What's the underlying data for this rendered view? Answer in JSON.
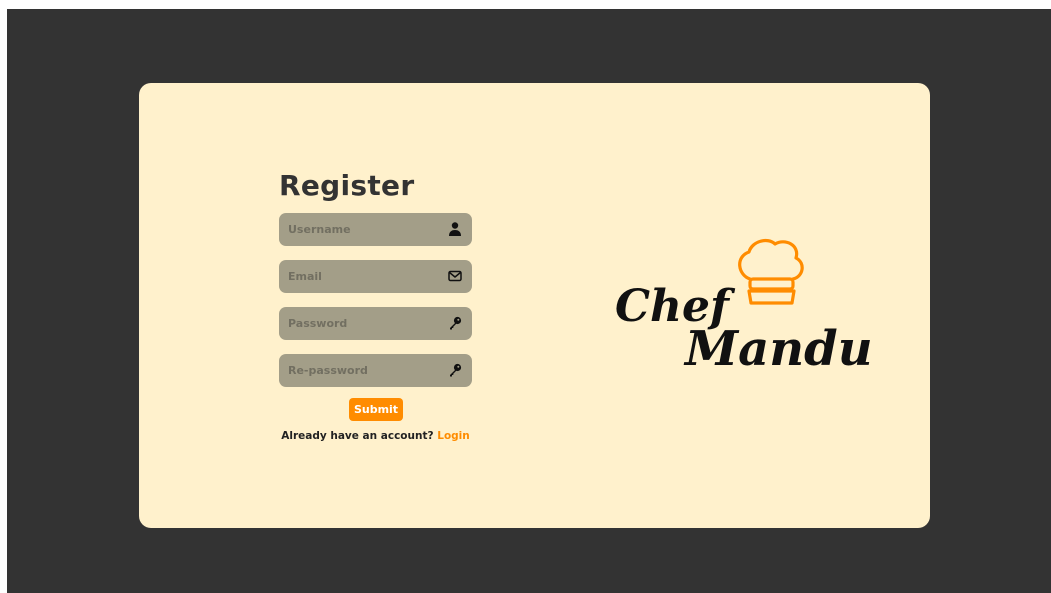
{
  "form": {
    "title": "Register",
    "fields": [
      {
        "name": "username",
        "placeholder": "Username",
        "value": "",
        "icon": "user-icon"
      },
      {
        "name": "email",
        "placeholder": "Email",
        "value": "",
        "icon": "envelope-icon"
      },
      {
        "name": "password",
        "placeholder": "Password",
        "value": "",
        "icon": "key-icon"
      },
      {
        "name": "repassword",
        "placeholder": "Re-password",
        "value": "",
        "icon": "key-icon"
      }
    ],
    "submit_label": "Submit",
    "login_prompt": "Already have an account?",
    "login_link": "Login"
  },
  "logo": {
    "line1": "Chef",
    "line2": "Mandu",
    "icon": "chef-hat-icon"
  },
  "colors": {
    "page_background": "#333333",
    "card_background": "#fff1cc",
    "field_background": "#a39e88",
    "accent": "#ff8c00",
    "heading": "#333333"
  }
}
